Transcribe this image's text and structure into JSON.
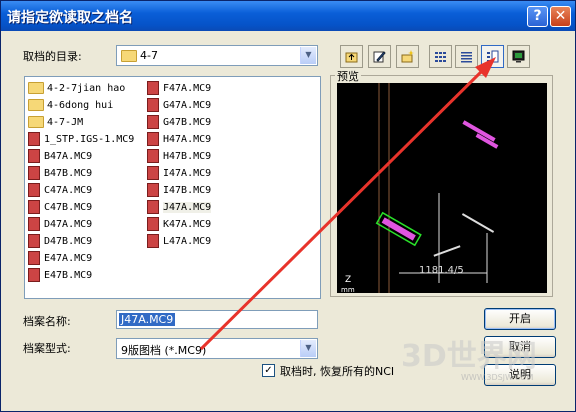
{
  "window": {
    "title": "请指定欲读取之档名",
    "help_glyph": "?",
    "close_glyph": "✕"
  },
  "directory": {
    "label": "取档的目录:",
    "value": "4-7"
  },
  "files": {
    "col1": [
      {
        "name": "4-2-7jian hao",
        "kind": "folder"
      },
      {
        "name": "4-6dong hui",
        "kind": "folder"
      },
      {
        "name": "4-7-JM",
        "kind": "folder"
      },
      {
        "name": "1_STP.IGS-1.MC9",
        "kind": "file"
      },
      {
        "name": "B47A.MC9",
        "kind": "file"
      },
      {
        "name": "B47B.MC9",
        "kind": "file"
      },
      {
        "name": "C47A.MC9",
        "kind": "file"
      },
      {
        "name": "C47B.MC9",
        "kind": "file"
      },
      {
        "name": "D47A.MC9",
        "kind": "file"
      },
      {
        "name": "D47B.MC9",
        "kind": "file"
      },
      {
        "name": "E47A.MC9",
        "kind": "file"
      },
      {
        "name": "E47B.MC9",
        "kind": "file"
      }
    ],
    "col2": [
      {
        "name": "F47A.MC9",
        "kind": "file"
      },
      {
        "name": "G47A.MC9",
        "kind": "file"
      },
      {
        "name": "G47B.MC9",
        "kind": "file"
      },
      {
        "name": "H47A.MC9",
        "kind": "file"
      },
      {
        "name": "H47B.MC9",
        "kind": "file"
      },
      {
        "name": "I47A.MC9",
        "kind": "file"
      },
      {
        "name": "I47B.MC9",
        "kind": "file"
      },
      {
        "name": "J47A.MC9",
        "kind": "file",
        "selected": true
      },
      {
        "name": "K47A.MC9",
        "kind": "file"
      },
      {
        "name": "L47A.MC9",
        "kind": "file"
      }
    ]
  },
  "preview": {
    "label": "预览",
    "dimension_text": "1181.4/5",
    "axis_label": "Z",
    "unit_label": "mm"
  },
  "filename": {
    "label": "档案名称:",
    "value": "J47A.MC9"
  },
  "filetype": {
    "label": "档案型式:",
    "value": "9版图档 (*.MC9)"
  },
  "restore_nci": {
    "label": "取档时, 恢复所有的NCI",
    "checked": true,
    "check_glyph": "✓"
  },
  "buttons": {
    "open": "开启",
    "cancel": "取消",
    "help": "说明"
  },
  "watermark": {
    "text": "3D世界网",
    "url": "WWW.3DSJW.COM"
  },
  "colors": {
    "titlebar": "#0553c8",
    "selection": "#316ac5",
    "annotation_arrow": "#e8332b"
  }
}
